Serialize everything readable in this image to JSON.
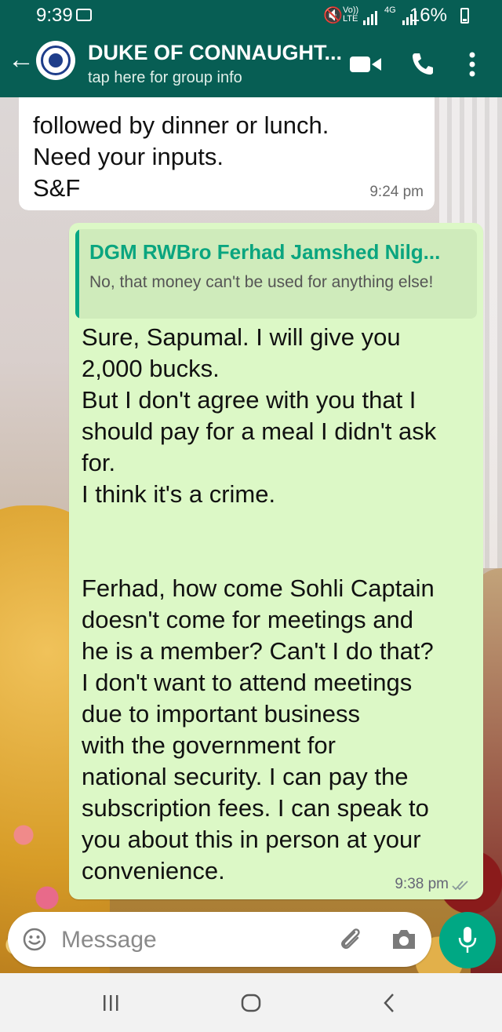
{
  "status_bar": {
    "time": "9:39",
    "network_1": "Vo))\nLTE",
    "network_2": "4G",
    "battery": "16%"
  },
  "header": {
    "group_name": "DUKE OF CONNAUGHT...",
    "subtitle": "tap here for group info",
    "color": "#075e54"
  },
  "messages": {
    "incoming": {
      "text": "followed by dinner or lunch.\nNeed your inputs.\nS&F",
      "time": "9:24 pm"
    },
    "outgoing": {
      "quoted_sender": "DGM RWBro Ferhad Jamshed Nilg...",
      "quoted_text": "No, that money can't be used for anything else!",
      "text": "Sure, Sapumal. I will give you\n2,000 bucks.\nBut I don't agree with you that I\nshould pay for a meal I didn't ask\nfor.\nI think it's a crime.\n\n\nFerhad, how come Sohli Captain\ndoesn't come for meetings and\nhe is a member? Can't I do that?\nI don't want to attend meetings\ndue to important business\nwith the government for\nnational security. I can pay the\nsubscription fees. I can speak to\nyou about this in person at your\nconvenience.",
      "time": "9:38 pm",
      "bubble_color": "#dcf8c6"
    }
  },
  "composer": {
    "placeholder": "Message"
  },
  "icons": [
    "back-arrow-icon",
    "group-avatar",
    "video-call-icon",
    "voice-call-icon",
    "more-options-icon",
    "emoji-icon",
    "attach-icon",
    "camera-icon",
    "mic-icon",
    "read-ticks-icon"
  ]
}
